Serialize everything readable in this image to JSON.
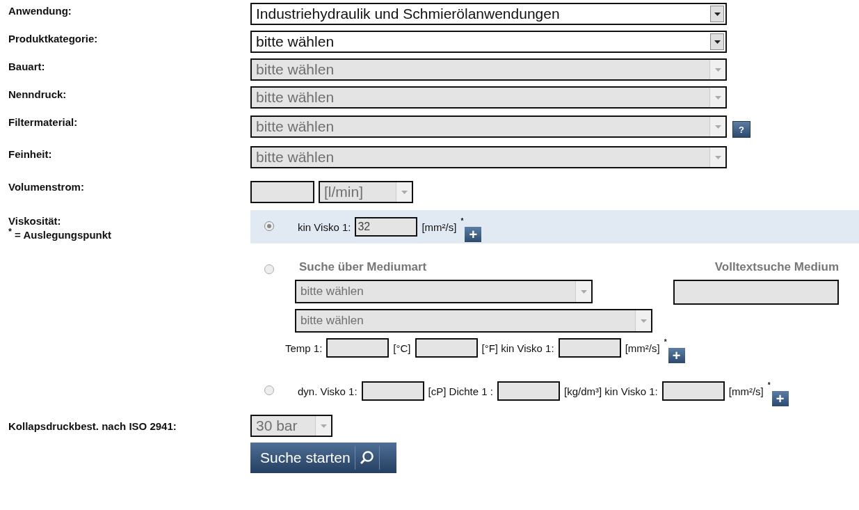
{
  "selects": [
    {
      "label": "Anwendung:",
      "value": "Industriehydraulik und Schmierölanwendungen",
      "disabled": false
    },
    {
      "label": "Produktkategorie:",
      "value": "bitte wählen",
      "disabled": false
    },
    {
      "label": "Bauart:",
      "value": "bitte wählen",
      "disabled": true
    },
    {
      "label": "Nenndruck:",
      "value": "bitte wählen",
      "disabled": true
    },
    {
      "label": "Filtermaterial:",
      "value": "bitte wählen",
      "disabled": true,
      "help": "?"
    },
    {
      "label": "Feinheit:",
      "value": "bitte wählen",
      "disabled": true
    }
  ],
  "flow": {
    "label": "Volumenstrom:",
    "unit": "[l/min]",
    "disabled": true
  },
  "viscosity": {
    "label": "Viskosität:",
    "note": "$^{*}$ = Auslegungspunkt",
    "options": [
      {
        "kind": "simple",
        "selected": true,
        "parts": [
          {
            "kind": "text",
            "text": "kin Visko 1:"
          },
          {
            "kind": "field",
            "value": "32"
          },
          {
            "kind": "text",
            "text": "[mm²/s]"
          },
          {
            "kind": "mark",
            "text": "*"
          },
          {
            "kind": "add",
            "text": "+"
          }
        ]
      },
      {
        "kind": "medium",
        "selected": false,
        "heading": "Suche über Mediumart",
        "fulltext_heading": "Volltextsuche Medium",
        "selects": [
          "bitte wählen",
          "bitte wählen"
        ],
        "parts": [
          {
            "kind": "text",
            "text": "Temp 1:"
          },
          {
            "kind": "field"
          },
          {
            "kind": "text",
            "text": "[°C]"
          },
          {
            "kind": "field"
          },
          {
            "kind": "text",
            "text": "[°F] kin Visko 1:"
          },
          {
            "kind": "field"
          },
          {
            "kind": "text",
            "text": "[mm²/s]"
          },
          {
            "kind": "mark",
            "text": "*"
          },
          {
            "kind": "add",
            "text": "+"
          }
        ]
      },
      {
        "kind": "simple",
        "selected": false,
        "parts": [
          {
            "kind": "text",
            "text": "dyn. Visko 1:"
          },
          {
            "kind": "field"
          },
          {
            "kind": "text",
            "text": "[cP] Dichte 1 :"
          },
          {
            "kind": "field"
          },
          {
            "kind": "text",
            "text": "[kg/dm³] kin Visko 1:"
          },
          {
            "kind": "field"
          },
          {
            "kind": "text",
            "text": "[mm²/s]"
          },
          {
            "kind": "mark",
            "text": "*"
          },
          {
            "kind": "add",
            "text": "+"
          }
        ]
      }
    ]
  },
  "collapse": {
    "label": "Kollapsdruckbest. nach ISO 2941:",
    "value": "30 bar",
    "disabled": true
  },
  "button": "Suche starten"
}
